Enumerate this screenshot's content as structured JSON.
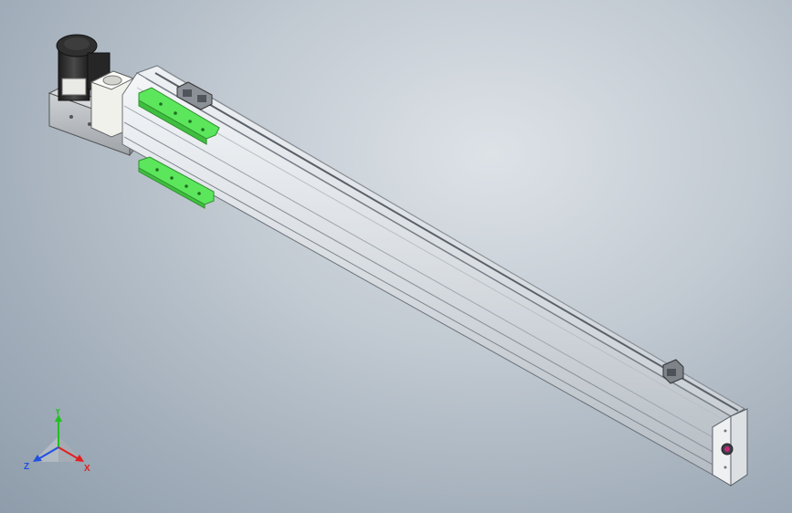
{
  "viewport": {
    "background_top": "#dde2e7",
    "background_bottom": "#8e9cab"
  },
  "model": {
    "profile_color": "#d9dde2",
    "rail_color": "#5a6068",
    "rib_color": "#9fa6ae",
    "accent_green": "#5ce65c",
    "motor_color": "#2a2a2a",
    "mount_block_color": "#b8bcc0",
    "coupler_color": "#f2f2ee",
    "end_cap_color": "#eef0f2",
    "end_cap_marker_color": "#c0287a"
  },
  "triad": {
    "x_label": "X",
    "y_label": "Y",
    "z_label": "Z",
    "x_color": "#e02020",
    "y_color": "#20c020",
    "z_color": "#2050e0"
  }
}
